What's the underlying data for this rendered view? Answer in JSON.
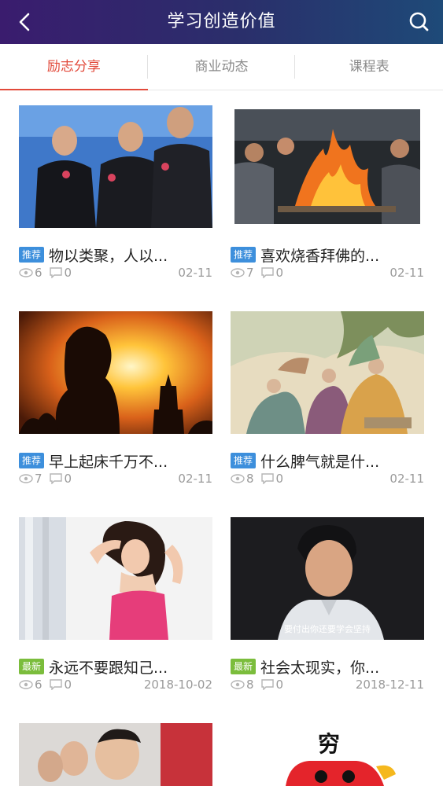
{
  "header": {
    "title": "学习创造价值"
  },
  "tabs": [
    {
      "label": "励志分享"
    },
    {
      "label": "商业动态"
    },
    {
      "label": "课程表"
    }
  ],
  "cards": [
    {
      "badge": "推荐",
      "title": "物以类聚，人以...",
      "views": "6",
      "comments": "0",
      "date": "02-11"
    },
    {
      "badge": "推荐",
      "title": "喜欢烧香拜佛的...",
      "views": "7",
      "comments": "0",
      "date": "02-11"
    },
    {
      "badge": "推荐",
      "title": "早上起床千万不...",
      "views": "7",
      "comments": "0",
      "date": "02-11"
    },
    {
      "badge": "推荐",
      "title": "什么脾气就是什...",
      "views": "8",
      "comments": "0",
      "date": "02-11"
    },
    {
      "badge": "最新",
      "title": "永远不要跟知己...",
      "views": "6",
      "comments": "0",
      "date": "2018-10-02"
    },
    {
      "badge": "最新",
      "title": "社会太现实，你...",
      "views": "8",
      "comments": "0",
      "date": "2018-12-11"
    }
  ],
  "images": {
    "subtitle_caption": "要付出你还要学会坚持",
    "sticker_text": "穷"
  }
}
